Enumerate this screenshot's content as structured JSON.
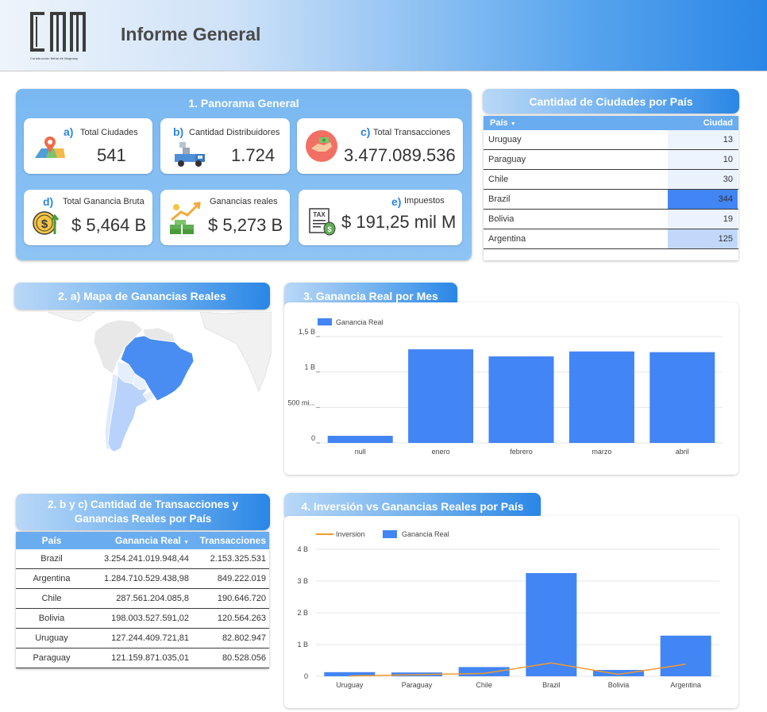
{
  "header": {
    "logo_text": "CMM",
    "logo_subtitle": "Construcción Metal de Magnasy",
    "title": "Informe General"
  },
  "panorama": {
    "title": "1. Panorama General",
    "kpis": [
      {
        "letter": "a)",
        "label": "Total Ciudades",
        "value": "541",
        "icon": "map-pin-icon"
      },
      {
        "letter": "b)",
        "label": "Cantidad Distribuidores",
        "value": "1.724",
        "icon": "delivery-truck-icon"
      },
      {
        "letter": "c)",
        "label": "Total Transacciones",
        "value": "3.477.089.536",
        "icon": "handshake-money-icon"
      },
      {
        "letter": "d)",
        "label": "Total Ganancia Bruta",
        "value": "$ 5,464 B",
        "icon": "coin-growth-icon"
      },
      {
        "letter": "",
        "label": "Ganancias reales",
        "value": "$ 5,273 B",
        "icon": "money-growth-icon"
      },
      {
        "letter": "e)",
        "label": "Impuestos",
        "value": "$ 191,25 mil M",
        "icon": "tax-document-icon"
      }
    ]
  },
  "cities_table": {
    "title": "Cantidad de Ciudades por País",
    "col_country": "País",
    "col_city": "Ciudad",
    "sort_indicator": "▼",
    "rows": [
      {
        "country": "Uruguay",
        "value": "13",
        "shade": "#eef4fe"
      },
      {
        "country": "Paraguay",
        "value": "10",
        "shade": "#eef4fe"
      },
      {
        "country": "Chile",
        "value": "30",
        "shade": "#eaf2fd"
      },
      {
        "country": "Brazil",
        "value": "344",
        "shade": "#4285f4"
      },
      {
        "country": "Bolivia",
        "value": "19",
        "shade": "#ecf3fe"
      },
      {
        "country": "Argentina",
        "value": "125",
        "shade": "#c2d8fb"
      }
    ]
  },
  "map": {
    "title": "2. a) Mapa de Ganancias Reales"
  },
  "monthly_chart": {
    "title": "3. Ganancia Real por Mes",
    "chart_data": {
      "type": "bar",
      "categories": [
        "null",
        "enero",
        "febrero",
        "marzo",
        "abril"
      ],
      "series": [
        {
          "name": "Ganancia Real",
          "values": [
            0.1,
            1.32,
            1.22,
            1.29,
            1.28
          ],
          "color": "#4285f4"
        }
      ],
      "ylim": [
        0,
        1.5
      ],
      "ytick_values": [
        0,
        0.5,
        1,
        1.5
      ],
      "ytick_labels": [
        "0",
        "500 mi...",
        "1 B",
        "1,5 B"
      ],
      "unit": "B"
    }
  },
  "transactions_table": {
    "title_line1": "2. b y c) Cantidad de Transacciones y",
    "title_line2": "Ganancias Reales por País",
    "col_country": "País",
    "col_gain": "Ganancia Real",
    "col_tx": "Transacciones",
    "sort_indicator": "▼",
    "rows": [
      {
        "country": "Brazil",
        "gain": "3.254.241.019.948,44",
        "tx": "2.153.325.531"
      },
      {
        "country": "Argentina",
        "gain": "1.284.710.529.438,98",
        "tx": "849.222.019"
      },
      {
        "country": "Chile",
        "gain": "287.561.204.085,8",
        "tx": "190.646.720"
      },
      {
        "country": "Bolivia",
        "gain": "198.003.527.591,02",
        "tx": "120.564.263"
      },
      {
        "country": "Uruguay",
        "gain": "127.244.409.721,81",
        "tx": "82.802.947"
      },
      {
        "country": "Paraguay",
        "gain": "121.159.871.035,01",
        "tx": "80.528.056"
      }
    ]
  },
  "invest_chart": {
    "title": "4. Inversión vs Ganancias Reales por País",
    "chart_data": {
      "type": "bar",
      "categories": [
        "Uruguay",
        "Paraguay",
        "Chile",
        "Brazil",
        "Bolivia",
        "Argentina"
      ],
      "series": [
        {
          "name": "Inversion",
          "kind": "line",
          "values": [
            0.01,
            0.05,
            0.09,
            0.42,
            0.06,
            0.38
          ],
          "color": "#f29b2e"
        },
        {
          "name": "Ganancia Real",
          "kind": "bar",
          "values": [
            0.13,
            0.12,
            0.29,
            3.25,
            0.2,
            1.28
          ],
          "color": "#4285f4"
        }
      ],
      "ylim": [
        0,
        4
      ],
      "ytick_values": [
        0,
        1,
        2,
        3,
        4
      ],
      "ytick_labels": [
        "0",
        "1 B",
        "2 B",
        "3 B",
        "4 B"
      ],
      "unit": "B"
    }
  }
}
